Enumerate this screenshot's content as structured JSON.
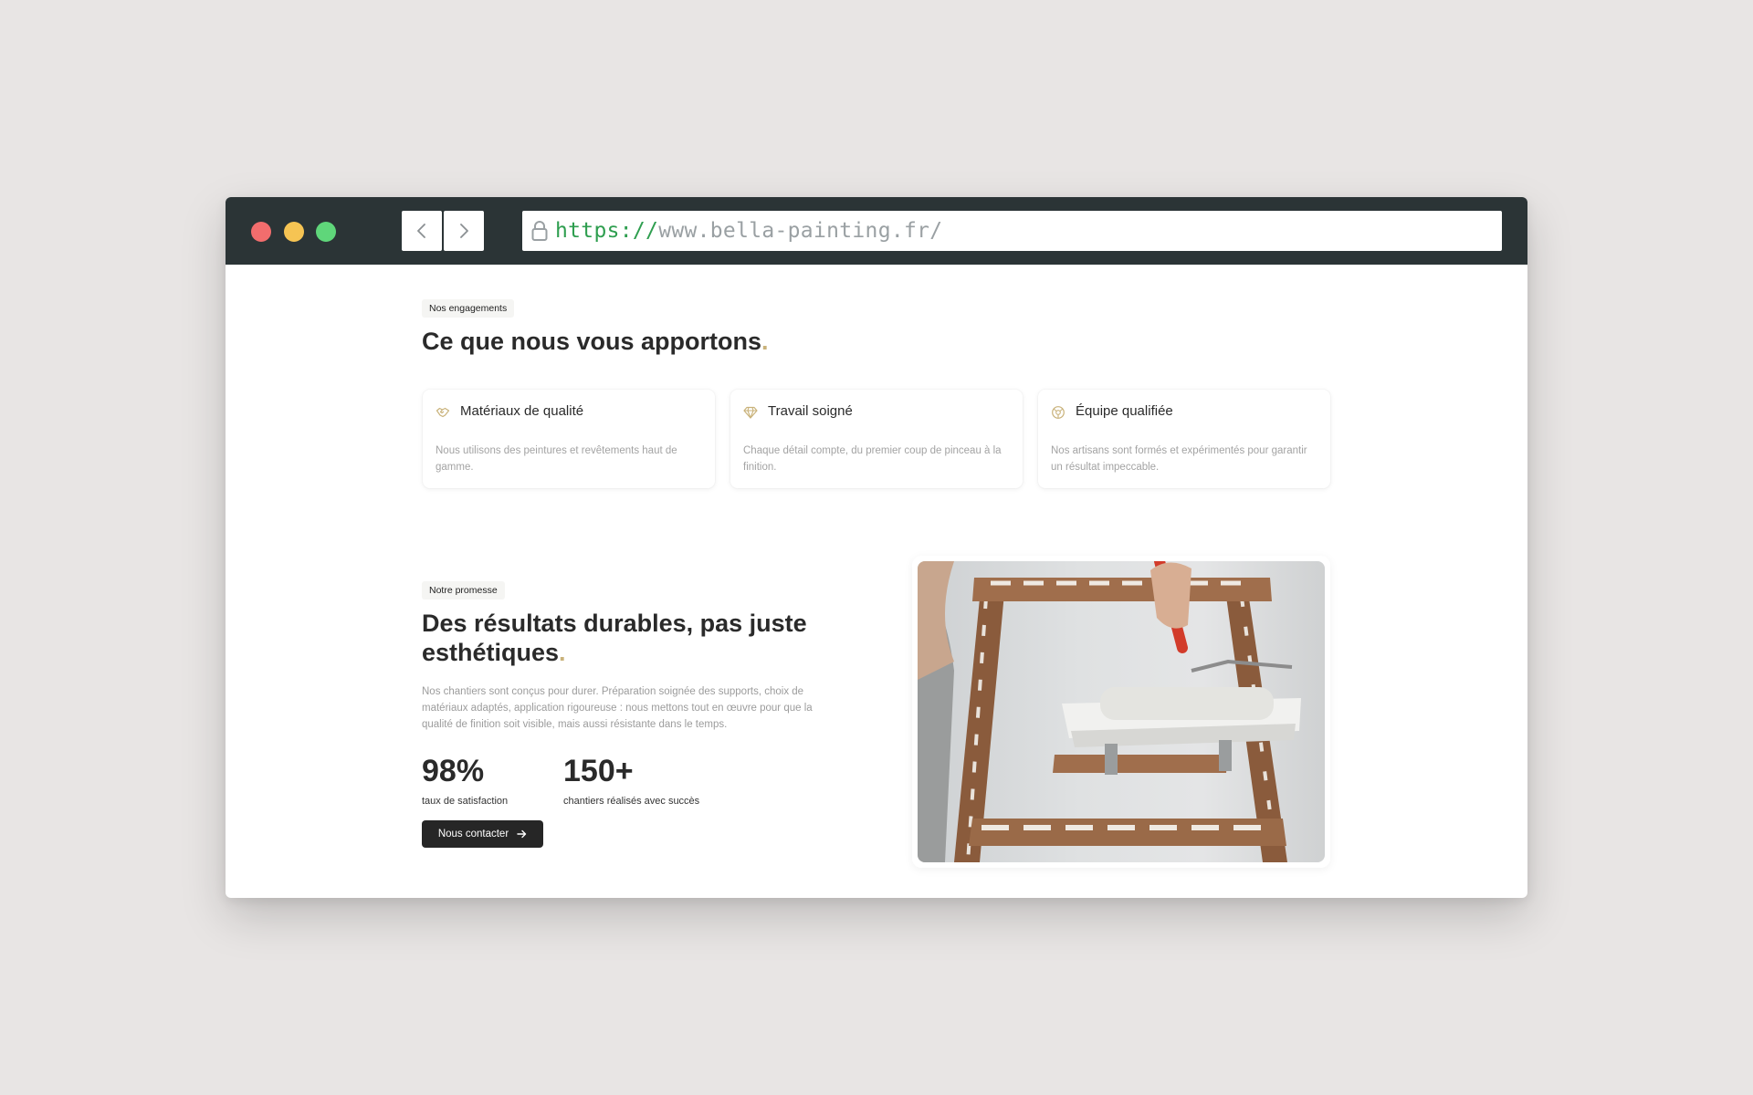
{
  "browser": {
    "url_protocol": "https://",
    "url_host": "www.bella-painting.fr/"
  },
  "engagements": {
    "pill": "Nos engagements",
    "title": "Ce que nous vous apportons",
    "title_dot": ".",
    "cards": [
      {
        "icon": "handshake-icon",
        "title": "Matériaux de qualité",
        "desc": "Nous utilisons des peintures et revêtements haut de gamme."
      },
      {
        "icon": "diamond-icon",
        "title": "Travail soigné",
        "desc": "Chaque détail compte, du premier coup de pinceau à la finition."
      },
      {
        "icon": "team-icon",
        "title": "Équipe qualifiée",
        "desc": "Nos artisans sont formés et expérimentés pour garantir un résultat impeccable."
      }
    ]
  },
  "promesse": {
    "pill": "Notre promesse",
    "title_line1": "Des résultats durables, pas juste",
    "title_line2": "esthétiques",
    "title_dot": ".",
    "paragraph": "Nos chantiers sont conçus pour durer. Préparation soignée des supports, choix de matériaux adaptés, application rigoureuse : nous mettons tout en œuvre pour que la qualité de finition soit visible, mais aussi résistante dans le temps.",
    "stats": [
      {
        "value": "98%",
        "label": "taux de satisfaction"
      },
      {
        "value": "150+",
        "label": "chantiers réalisés avec succès"
      }
    ],
    "cta_label": "Nous contacter"
  },
  "colors": {
    "accent": "#c9b27a",
    "titlebar": "#2b3436",
    "url_protocol": "#2e9e4f"
  }
}
